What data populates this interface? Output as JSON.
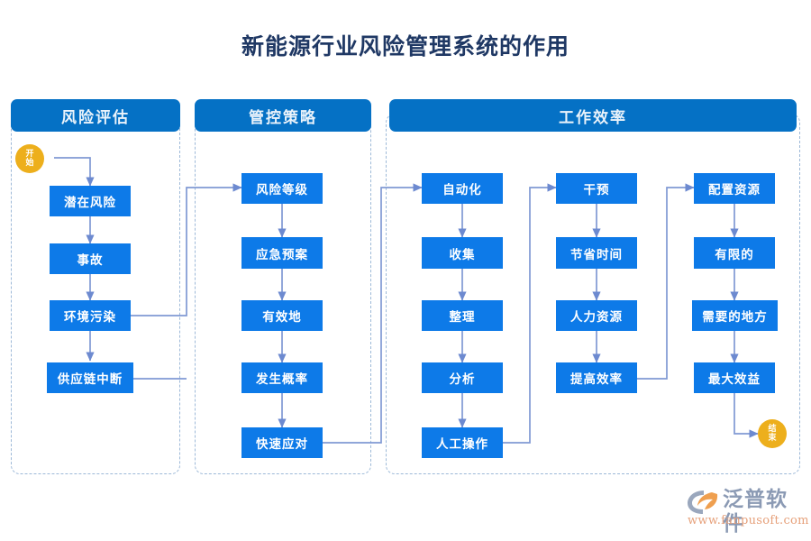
{
  "title": "新能源行业风险管理系统的作用",
  "groups": [
    {
      "id": "risk-assessment",
      "label": "风险评估"
    },
    {
      "id": "control-strategy",
      "label": "管控策略"
    },
    {
      "id": "work-efficiency",
      "label": "工作效率"
    }
  ],
  "terminators": {
    "start": {
      "line1": "开",
      "line2": "始"
    },
    "end": {
      "line1": "结",
      "line2": "束"
    }
  },
  "columns": [
    {
      "id": "column-risk",
      "nodes": [
        "潜在风险",
        "事故",
        "环境污染",
        "供应链中断"
      ]
    },
    {
      "id": "column-strategy",
      "nodes": [
        "风险等级",
        "应急预案",
        "有效地",
        "发生概率",
        "快速应对"
      ]
    },
    {
      "id": "column-automation",
      "nodes": [
        "自动化",
        "收集",
        "整理",
        "分析",
        "人工操作"
      ]
    },
    {
      "id": "column-intervention",
      "nodes": [
        "干预",
        "节省时间",
        "人力资源",
        "提高效率"
      ]
    },
    {
      "id": "column-resource",
      "nodes": [
        "配置资源",
        "有限的",
        "需要的地方",
        "最大效益"
      ]
    }
  ],
  "logo": {
    "name_cn": "泛普软件",
    "url": "www.fanpusoft.com"
  },
  "colors": {
    "title": "#1f3864",
    "header": "#0571c5",
    "node": "#0d7ae8",
    "terminator": "#edaf1c",
    "connector": "#8099d4",
    "group_border": "#9db9d8"
  }
}
